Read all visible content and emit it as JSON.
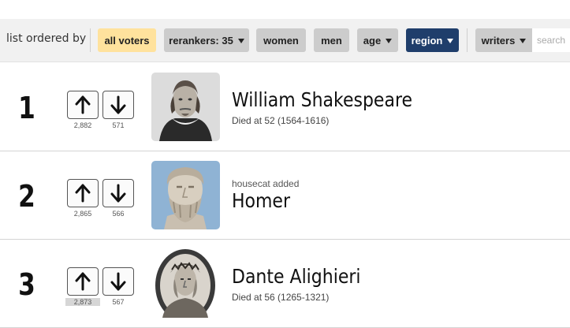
{
  "filters": {
    "label": "list ordered by",
    "all_voters": "all voters",
    "rerankers": "rerankers: 35",
    "women": "women",
    "men": "men",
    "age": "age",
    "region": "region",
    "writers": "writers",
    "search_placeholder": "search"
  },
  "items": [
    {
      "rank": "1",
      "name": "William Shakespeare",
      "subtitle": "Died at 52 (1564-1616)",
      "note": "",
      "upvotes": "2,882",
      "downvotes": "571",
      "portrait_icon": "shakespeare-portrait"
    },
    {
      "rank": "2",
      "name": "Homer",
      "subtitle": "",
      "note": "housecat added",
      "upvotes": "2,865",
      "downvotes": "566",
      "portrait_icon": "homer-bust"
    },
    {
      "rank": "3",
      "name": "Dante Alighieri",
      "subtitle": "Died at 56 (1265-1321)",
      "note": "",
      "upvotes": "2,873",
      "downvotes": "567",
      "portrait_icon": "dante-portrait"
    }
  ],
  "colors": {
    "active_chip": "#ffe29d",
    "region_chip": "#1f3e6b",
    "chip": "#cccccc"
  }
}
